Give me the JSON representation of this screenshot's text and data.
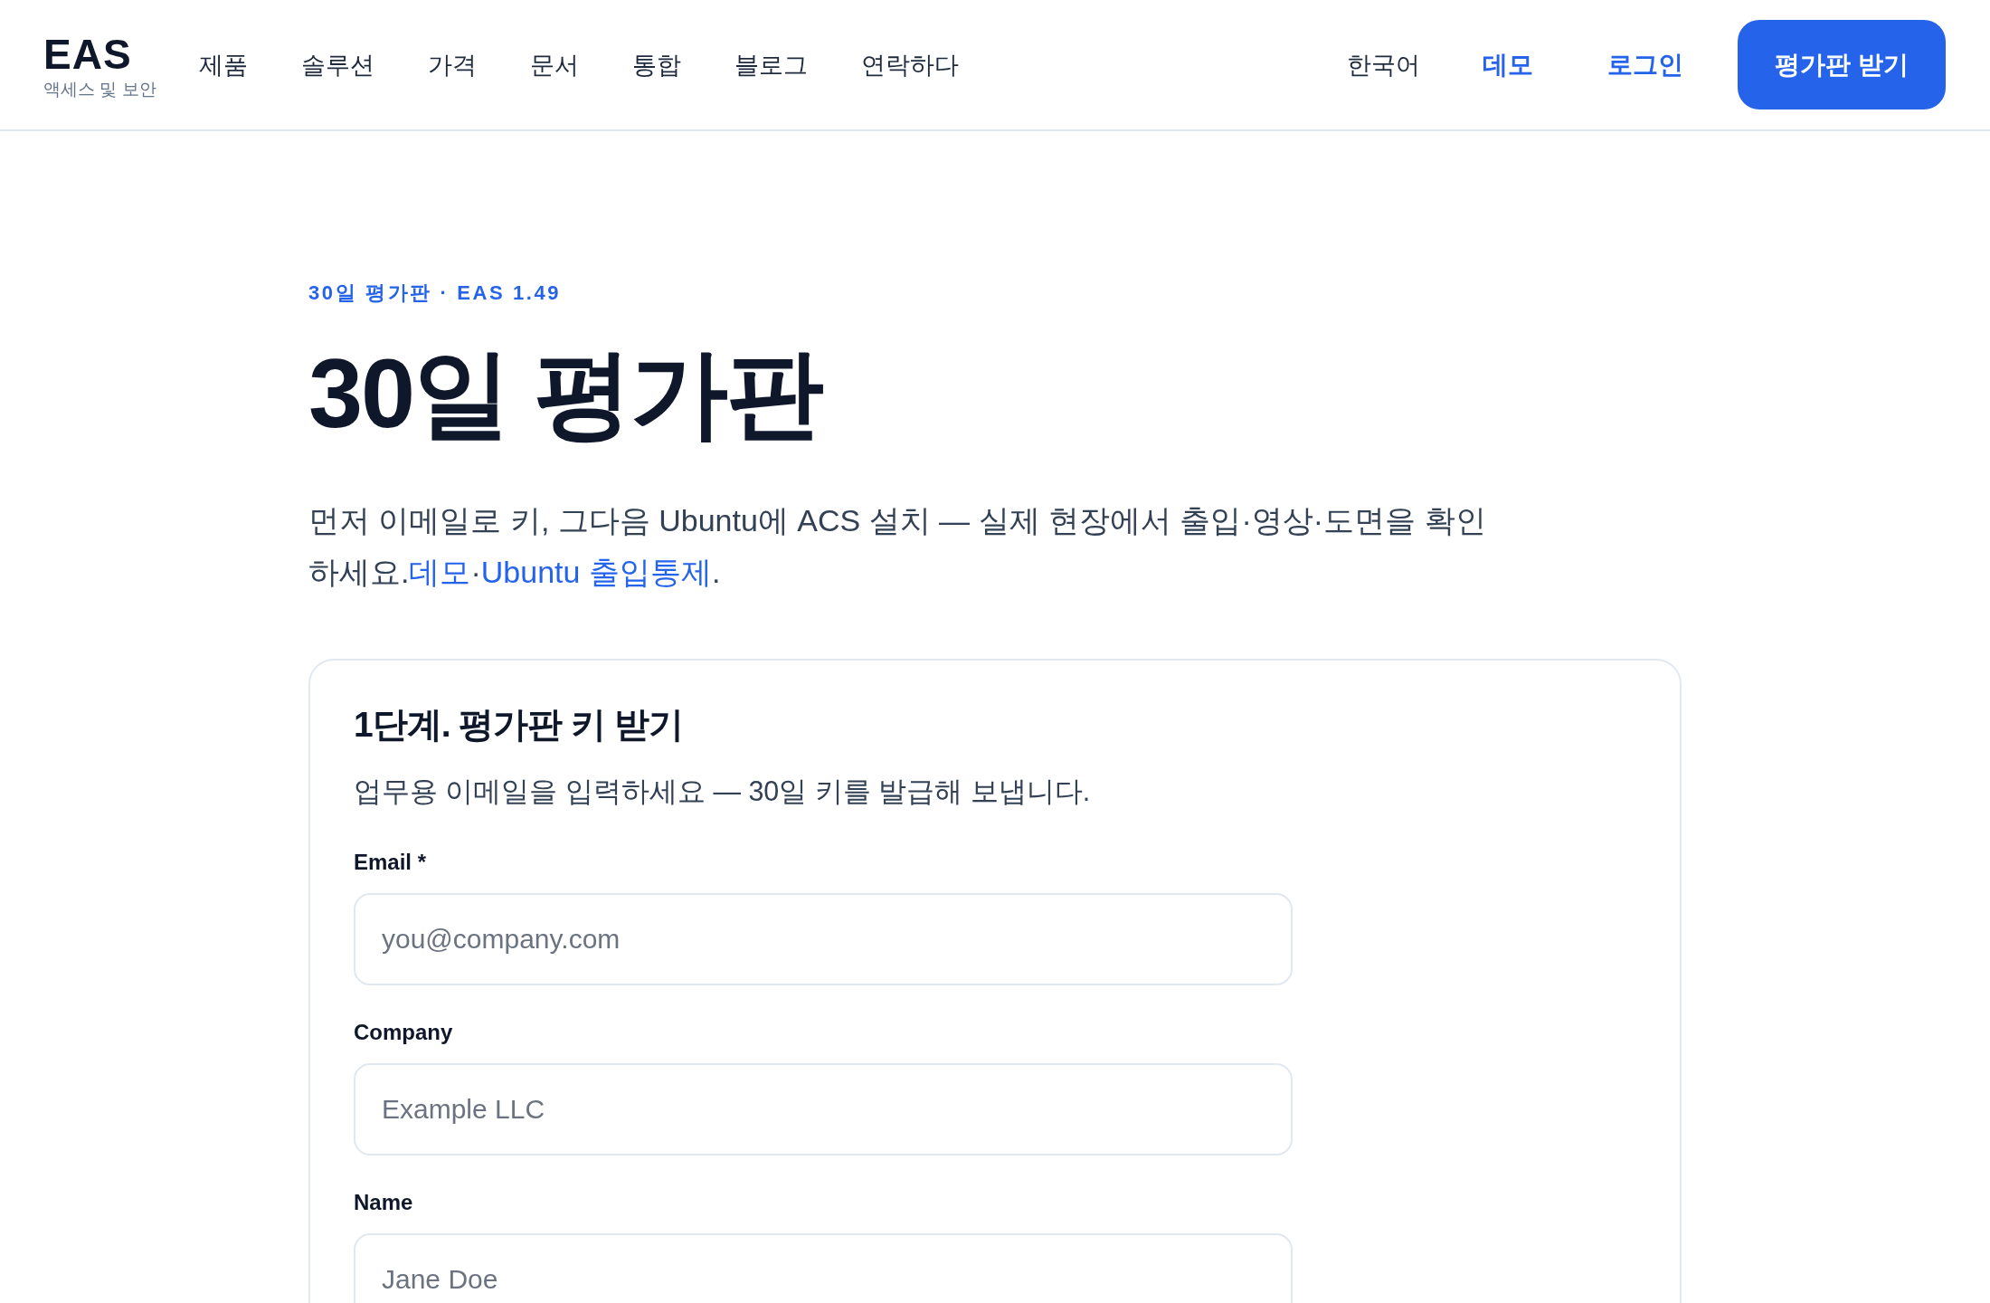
{
  "header": {
    "brand": {
      "name": "EAS",
      "tagline": "액세스 및 보안"
    },
    "nav": [
      {
        "label": "제품"
      },
      {
        "label": "솔루션"
      },
      {
        "label": "가격"
      },
      {
        "label": "문서"
      },
      {
        "label": "통합"
      },
      {
        "label": "블로그"
      },
      {
        "label": "연락하다"
      }
    ],
    "language": {
      "label": "한국어"
    },
    "links": [
      {
        "label": "데모"
      },
      {
        "label": "로그인"
      }
    ],
    "cta": {
      "label": "평가판 받기"
    }
  },
  "hero": {
    "eyebrow": "30일 평가판 · EAS 1.49",
    "title": "30일 평가판",
    "intro": [
      {
        "kind": "text",
        "text": "먼저 이메일로 키, 그다음 Ubuntu에 ACS 설치 — 실제 현장에서 출입·영상·도면을 확인하세요."
      },
      {
        "kind": "link",
        "text": "데모"
      },
      {
        "kind": "text",
        "text": "·"
      },
      {
        "kind": "link",
        "text": "Ubuntu 출입통제"
      },
      {
        "kind": "text",
        "text": "."
      }
    ]
  },
  "form_card": {
    "title": "1단계. 평가판 키 받기",
    "subtitle": "업무용 이메일을 입력하세요 — 30일 키를 발급해 보냅니다.",
    "fields": [
      {
        "label": "Email *",
        "placeholder": "you@company.com"
      },
      {
        "label": "Company",
        "placeholder": "Example LLC"
      },
      {
        "label": "Name",
        "placeholder": "Jane Doe"
      }
    ]
  }
}
